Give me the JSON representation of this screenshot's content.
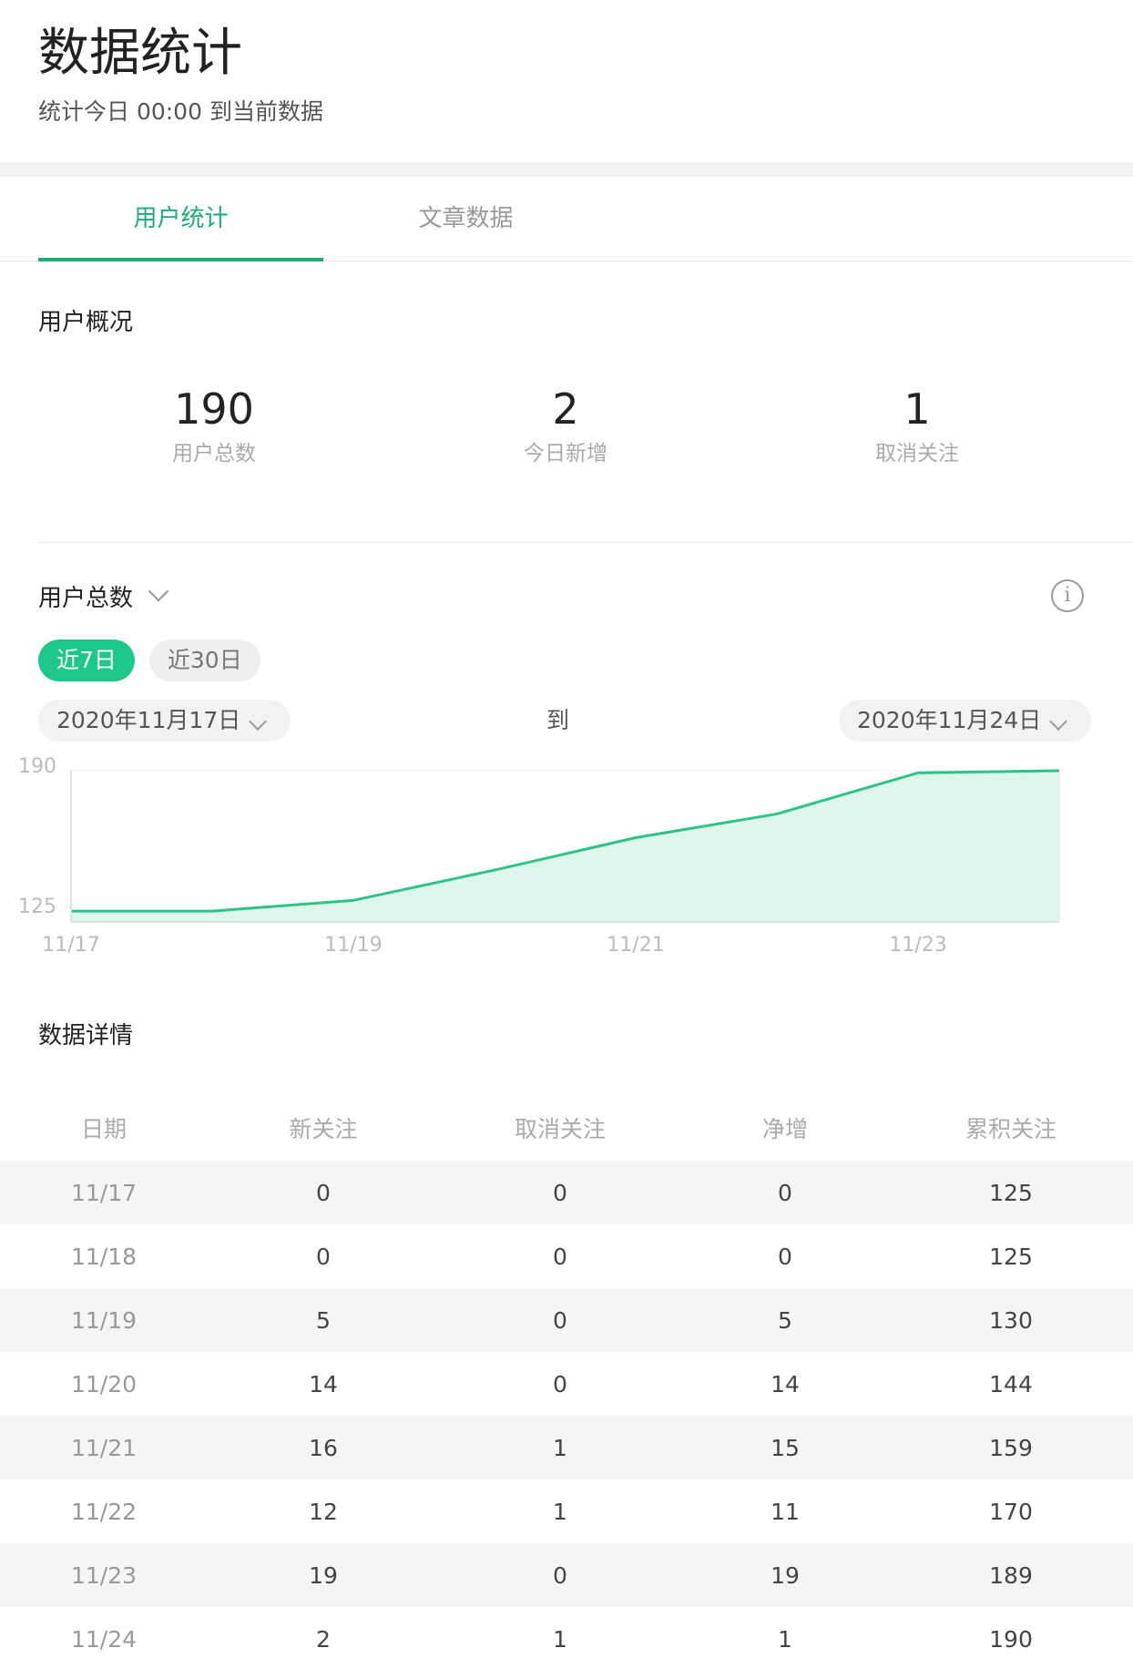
{
  "header": {
    "title": "数据统计",
    "subtitle": "统计今日 00:00 到当前数据"
  },
  "tabs": [
    {
      "label": "用户统计",
      "active": true
    },
    {
      "label": "文章数据",
      "active": false
    }
  ],
  "overview": {
    "title": "用户概况",
    "stats": [
      {
        "value": "190",
        "label": "用户总数"
      },
      {
        "value": "2",
        "label": "今日新增"
      },
      {
        "value": "1",
        "label": "取消关注"
      }
    ]
  },
  "metric": {
    "label": "用户总数",
    "info_icon": "info-icon",
    "ranges": [
      {
        "label": "近7日",
        "active": true
      },
      {
        "label": "近30日",
        "active": false
      }
    ],
    "date_from": "2020年11月17日",
    "date_separator": "到",
    "date_to": "2020年11月24日"
  },
  "colors": {
    "accent": "#1aad75",
    "chart_line": "#2bc487",
    "chart_fill": "#dff6ec"
  },
  "chart_data": {
    "type": "area",
    "x": [
      "11/17",
      "11/18",
      "11/19",
      "11/20",
      "11/21",
      "11/22",
      "11/23",
      "11/24"
    ],
    "series": [
      {
        "values": [
          125,
          125,
          130,
          144,
          159,
          170,
          189,
          190
        ]
      }
    ],
    "x_tick_labels": [
      "11/17",
      "11/19",
      "11/21",
      "11/23"
    ],
    "y_tick_labels": [
      "190",
      "125"
    ],
    "ylim": [
      120,
      190
    ],
    "grid": true
  },
  "details": {
    "title": "数据详情",
    "columns": [
      "日期",
      "新关注",
      "取消关注",
      "净增",
      "累积关注"
    ],
    "rows": [
      [
        "11/17",
        "0",
        "0",
        "0",
        "125"
      ],
      [
        "11/18",
        "0",
        "0",
        "0",
        "125"
      ],
      [
        "11/19",
        "5",
        "0",
        "5",
        "130"
      ],
      [
        "11/20",
        "14",
        "0",
        "14",
        "144"
      ],
      [
        "11/21",
        "16",
        "1",
        "15",
        "159"
      ],
      [
        "11/22",
        "12",
        "1",
        "11",
        "170"
      ],
      [
        "11/23",
        "19",
        "0",
        "19",
        "189"
      ],
      [
        "11/24",
        "2",
        "1",
        "1",
        "190"
      ]
    ]
  }
}
